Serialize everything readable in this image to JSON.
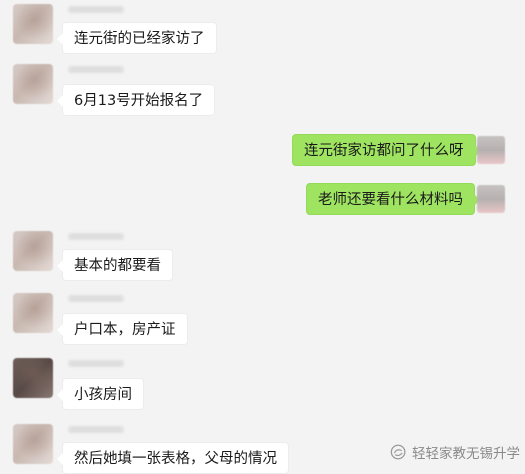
{
  "app_title": "",
  "messages": [
    {
      "side": "left",
      "text": "连元街的已经家访了"
    },
    {
      "side": "left",
      "text": "6月13号开始报名了"
    },
    {
      "side": "right",
      "text": "连元街家访都问了什么呀"
    },
    {
      "side": "right",
      "text": "老师还要看什么材料吗"
    },
    {
      "side": "left",
      "text": "基本的都要看"
    },
    {
      "side": "left",
      "text": "户口本，房产证"
    },
    {
      "side": "left",
      "text": "小孩房间"
    },
    {
      "side": "left",
      "text": "然后她填一张表格，父母的情况"
    }
  ],
  "watermark": {
    "icon": "wechat-public-account-icon",
    "text": "轻轻家教无锡升学"
  },
  "colors": {
    "background": "#f3f3f3",
    "incoming_bubble": "#ffffff",
    "outgoing_bubble": "#9ee461",
    "watermark_text": "#8a8a8a"
  }
}
